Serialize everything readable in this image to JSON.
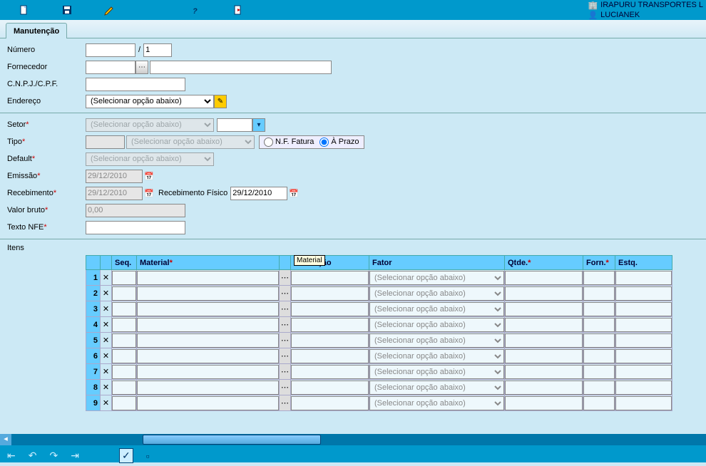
{
  "header": {
    "company": "IRAPURU TRANSPORTES L",
    "user": "LUCIANEK"
  },
  "tab": {
    "label": "Manutenção"
  },
  "form": {
    "numero_label": "Número",
    "numero_val": "",
    "numero_sep": "/",
    "numero_part2": "1",
    "fornecedor_label": "Fornecedor",
    "fornecedor_val": "",
    "fornecedor_desc": "",
    "cnpj_label": "C.N.P.J./C.P.F.",
    "cnpj_val": "",
    "endereco_label": "Endereço",
    "endereco_placeholder": "(Selecionar opção abaixo)",
    "setor_label": "Setor",
    "setor_placeholder": "(Selecionar opção abaixo)",
    "setor_extra": "",
    "tipo_label": "Tipo",
    "tipo_val": "",
    "tipo_placeholder": "(Selecionar opção abaixo)",
    "radio_nf": "N.F. Fatura",
    "radio_prazo": "À Prazo",
    "default_label": "Default",
    "default_placeholder": "(Selecionar opção abaixo)",
    "emissao_label": "Emissão",
    "emissao_val": "29/12/2010",
    "recebimento_label": "Recebimento",
    "recebimento_val": "29/12/2010",
    "recfis_label": "Recebimento Físico",
    "recfis_val": "29/12/2010",
    "valor_label": "Valor bruto",
    "valor_val": "0,00",
    "texto_label": "Texto NFE",
    "texto_val": ""
  },
  "tooltip": "Material",
  "itens": {
    "title": "Itens",
    "cols": {
      "seq": "Seq.",
      "material": "Material",
      "descricao": "Descrição",
      "fator": "Fator",
      "qtde": "Qtde.",
      "forn": "Forn.",
      "estq": "Estq."
    },
    "fator_placeholder": "(Selecionar opção abaixo)",
    "rows": [
      1,
      2,
      3,
      4,
      5,
      6,
      7,
      8,
      9
    ]
  }
}
